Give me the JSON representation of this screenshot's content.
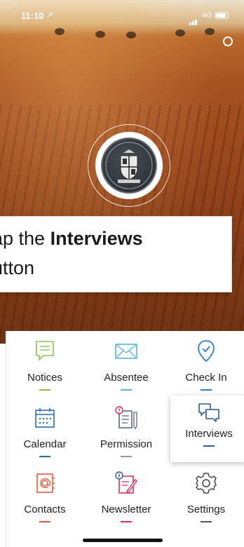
{
  "status_bar": {
    "time": "11:10",
    "location_arrow": "↗",
    "network": "4G"
  },
  "callout": {
    "line1_prefix": "ap the ",
    "line1_bold": "Interviews",
    "line2": "utton"
  },
  "menu": {
    "items": [
      {
        "label": "Notices",
        "icon": "notices-icon",
        "color": "#8cc152"
      },
      {
        "label": "Absentee",
        "icon": "absentee-icon",
        "color": "#58b6e0"
      },
      {
        "label": "Check In",
        "icon": "check-in-icon",
        "color": "#2b7cd3"
      },
      {
        "label": "Calendar",
        "icon": "calendar-icon",
        "color": "#2b6cb0"
      },
      {
        "label": "Permission",
        "icon": "permission-icon",
        "color": "#8a9ab0"
      },
      {
        "label": "Interviews",
        "icon": "interviews-icon",
        "color": "#2b5aa8"
      },
      {
        "label": "Contacts",
        "icon": "contacts-icon",
        "color": "#e85a3c"
      },
      {
        "label": "Newsletter",
        "icon": "newsletter-icon",
        "color": "#e0305a"
      },
      {
        "label": "Settings",
        "icon": "settings-icon",
        "color": "#555555"
      }
    ]
  },
  "accent_colors": {
    "notices": "#8cc152",
    "absentee": "#58b6e0",
    "check_in": "#2b7cd3",
    "contacts": "#e85a3c",
    "newsletter": "#e0305a"
  }
}
